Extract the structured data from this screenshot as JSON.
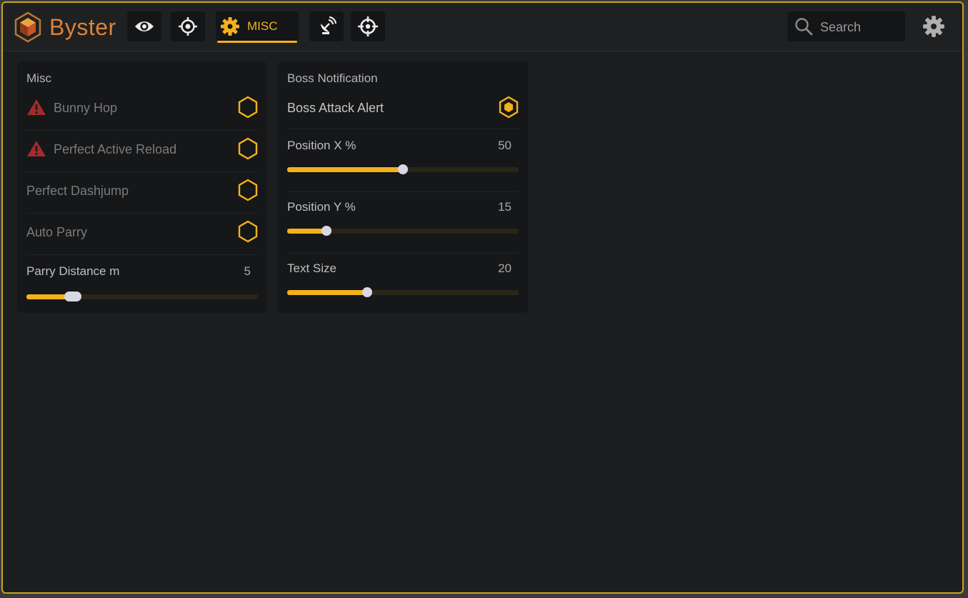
{
  "app": {
    "brand": "Byster"
  },
  "nav": {
    "tabs": [
      {
        "icon": "eye-icon"
      },
      {
        "icon": "target-icon"
      },
      {
        "icon": "gear-icon",
        "label": "MISC",
        "active": true
      },
      {
        "icon": "radar-icon"
      },
      {
        "icon": "crosshair-icon"
      }
    ]
  },
  "search": {
    "placeholder": "Search"
  },
  "colors": {
    "accent": "#f2b21c",
    "border": "#c9a227",
    "warning": "#b03030"
  },
  "misc": {
    "title": "Misc",
    "toggles": [
      {
        "label": "Bunny Hop",
        "warning": true,
        "checked": false
      },
      {
        "label": "Perfect Active Reload",
        "warning": true,
        "checked": false
      },
      {
        "label": "Perfect Dashjump",
        "warning": false,
        "checked": false
      },
      {
        "label": "Auto Parry",
        "warning": false,
        "checked": false
      }
    ],
    "slider": {
      "label": "Parry Distance m",
      "value": "5",
      "fraction": 0.2
    }
  },
  "boss": {
    "title": "Boss Notification",
    "toggle": {
      "label": "Boss Attack Alert",
      "checked": true
    },
    "sliders": [
      {
        "label": "Position X %",
        "value": "50",
        "fraction": 0.5
      },
      {
        "label": "Position Y %",
        "value": "15",
        "fraction": 0.17
      },
      {
        "label": "Text Size",
        "value": "20",
        "fraction": 0.345
      }
    ]
  }
}
